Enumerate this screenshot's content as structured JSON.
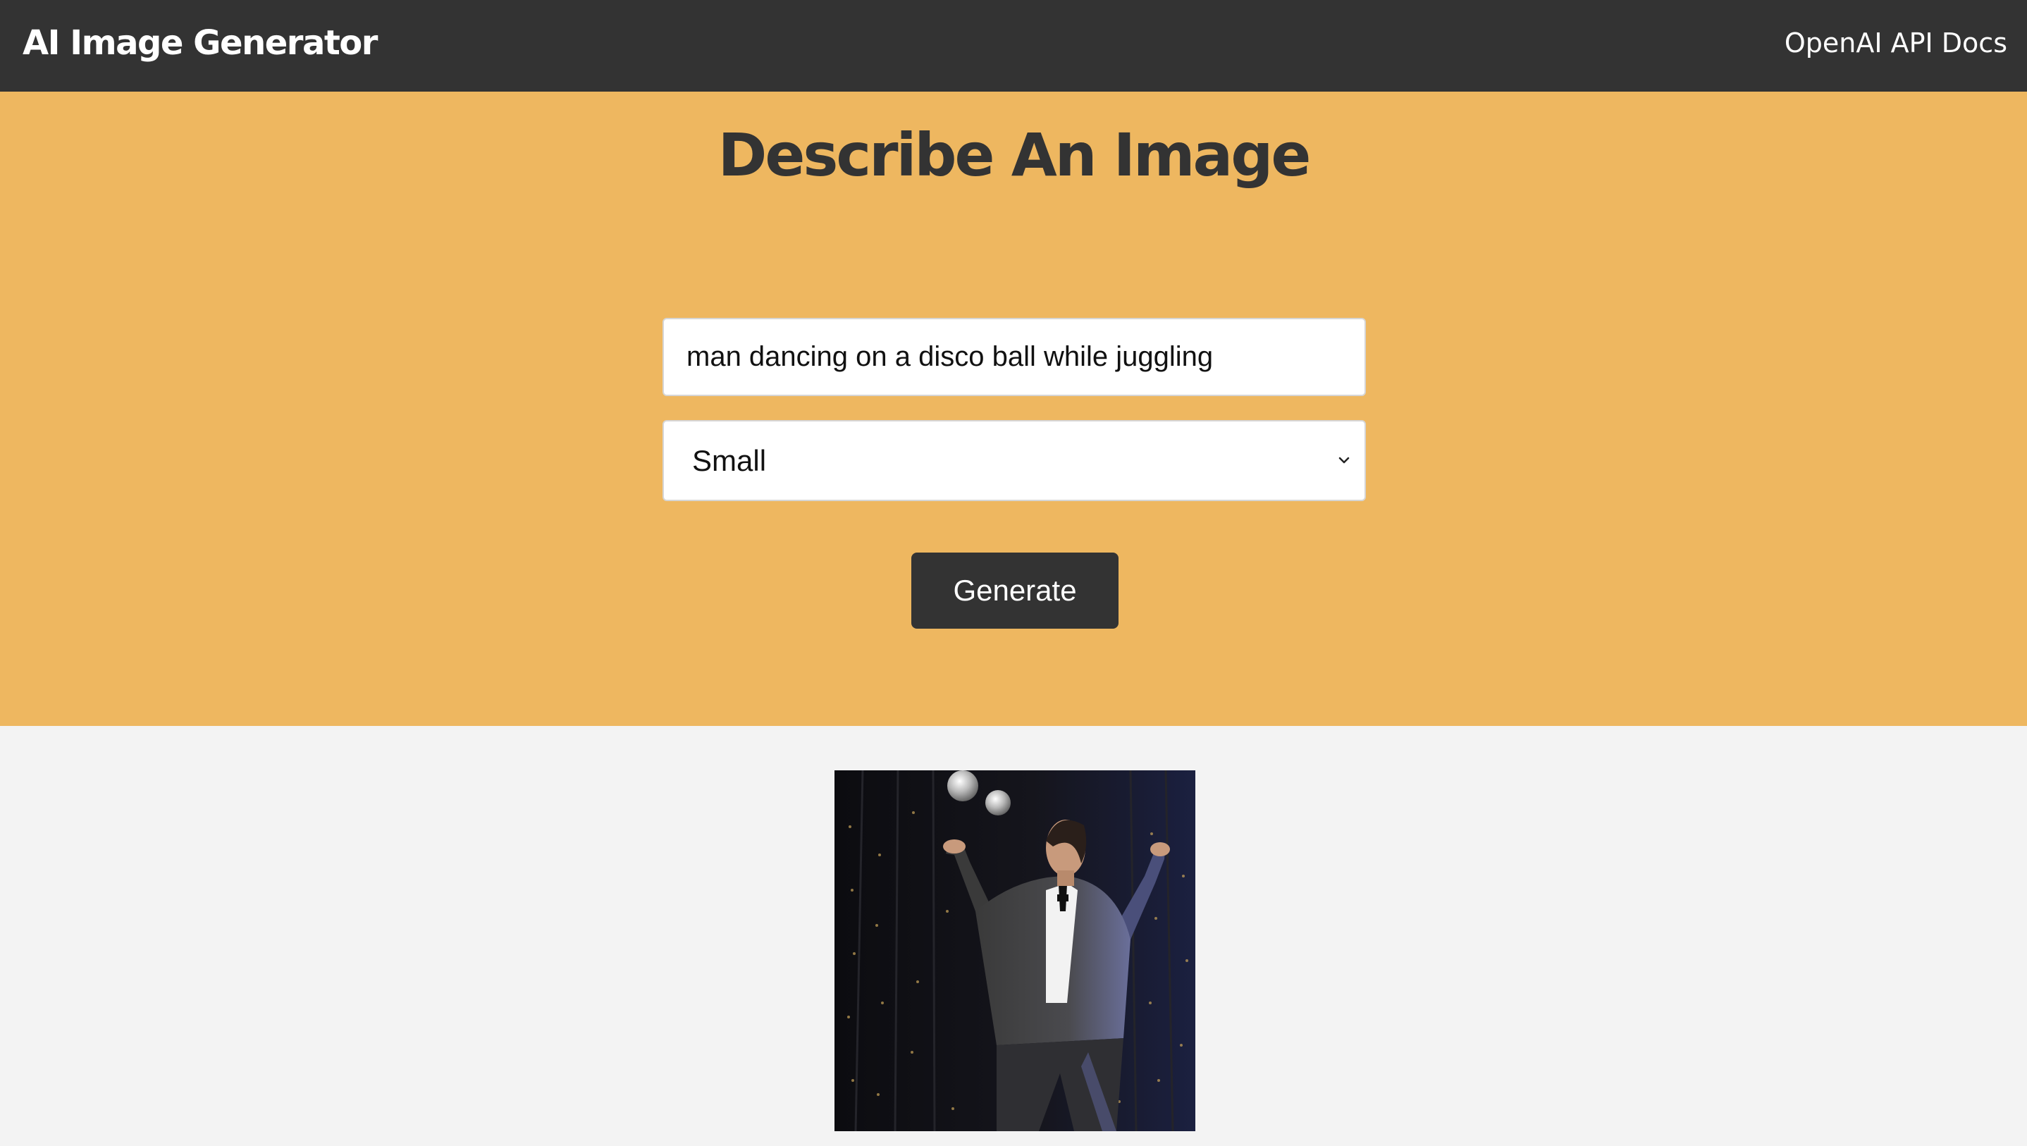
{
  "navbar": {
    "logo_text": "AI Image Generator",
    "docs_link": "OpenAI API Docs"
  },
  "form": {
    "heading": "Describe An Image",
    "prompt_value": "man dancing on a disco ball while juggling",
    "size_selected": "Small",
    "generate_label": "Generate"
  },
  "image": {
    "alt": "man dancing on a disco ball while juggling"
  },
  "colors": {
    "navbar_bg": "#333333",
    "showcase_bg": "#eeb760",
    "page_bg": "#f3f3f3",
    "button_bg": "#333333",
    "heading_text": "#333333"
  }
}
